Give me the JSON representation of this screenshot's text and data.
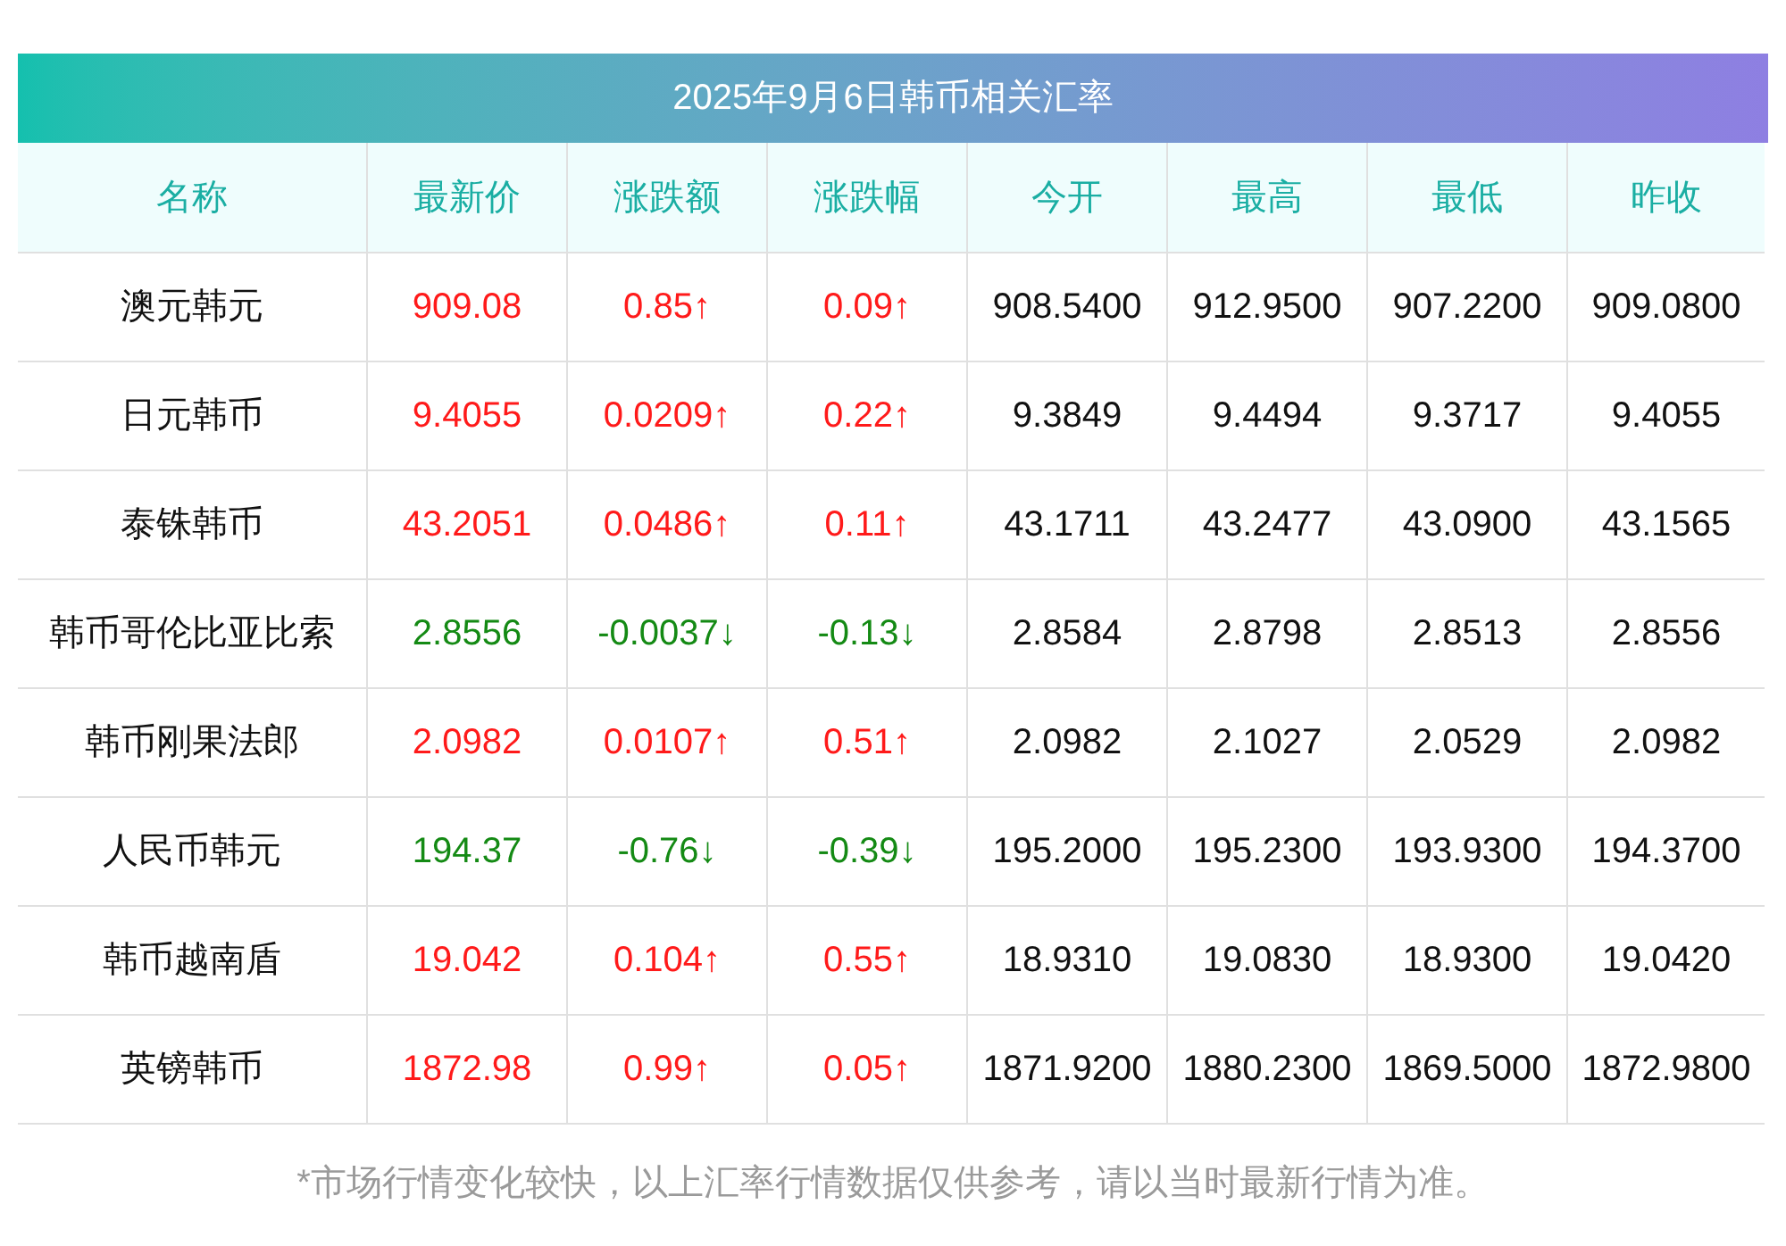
{
  "title": "2025年9月6日韩币相关汇率",
  "columns": [
    "名称",
    "最新价",
    "涨跌额",
    "涨跌幅",
    "今开",
    "最高",
    "最低",
    "昨收"
  ],
  "rows": [
    {
      "color": "#ff1a1a",
      "cells": [
        "澳元韩元",
        "909.08",
        "0.85↑",
        "0.09↑",
        "908.5400",
        "912.9500",
        "907.2200",
        "909.0800"
      ]
    },
    {
      "color": "#ff1a1a",
      "cells": [
        "日元韩币",
        "9.4055",
        "0.0209↑",
        "0.22↑",
        "9.3849",
        "9.4494",
        "9.3717",
        "9.4055"
      ]
    },
    {
      "color": "#ff1a1a",
      "cells": [
        "泰铢韩币",
        "43.2051",
        "0.0486↑",
        "0.11↑",
        "43.1711",
        "43.2477",
        "43.0900",
        "43.1565"
      ]
    },
    {
      "color": "#148a14",
      "cells": [
        "韩币哥伦比亚比索",
        "2.8556",
        "-0.0037↓",
        "-0.13↓",
        "2.8584",
        "2.8798",
        "2.8513",
        "2.8556"
      ]
    },
    {
      "color": "#ff1a1a",
      "cells": [
        "韩币刚果法郎",
        "2.0982",
        "0.0107↑",
        "0.51↑",
        "2.0982",
        "2.1027",
        "2.0529",
        "2.0982"
      ]
    },
    {
      "color": "#148a14",
      "cells": [
        "人民币韩元",
        "194.37",
        "-0.76↓",
        "-0.39↓",
        "195.2000",
        "195.2300",
        "193.9300",
        "194.3700"
      ]
    },
    {
      "color": "#ff1a1a",
      "cells": [
        "韩币越南盾",
        "19.042",
        "0.104↑",
        "0.55↑",
        "18.9310",
        "19.0830",
        "18.9300",
        "19.0420"
      ]
    },
    {
      "color": "#ff1a1a",
      "cells": [
        "英镑韩币",
        "1872.98",
        "0.99↑",
        "0.05↑",
        "1871.9200",
        "1880.2300",
        "1869.5000",
        "1872.9800"
      ]
    }
  ],
  "footnote": "*市场行情变化较快，以上汇率行情数据仅供参考，请以当时最新行情为准。"
}
